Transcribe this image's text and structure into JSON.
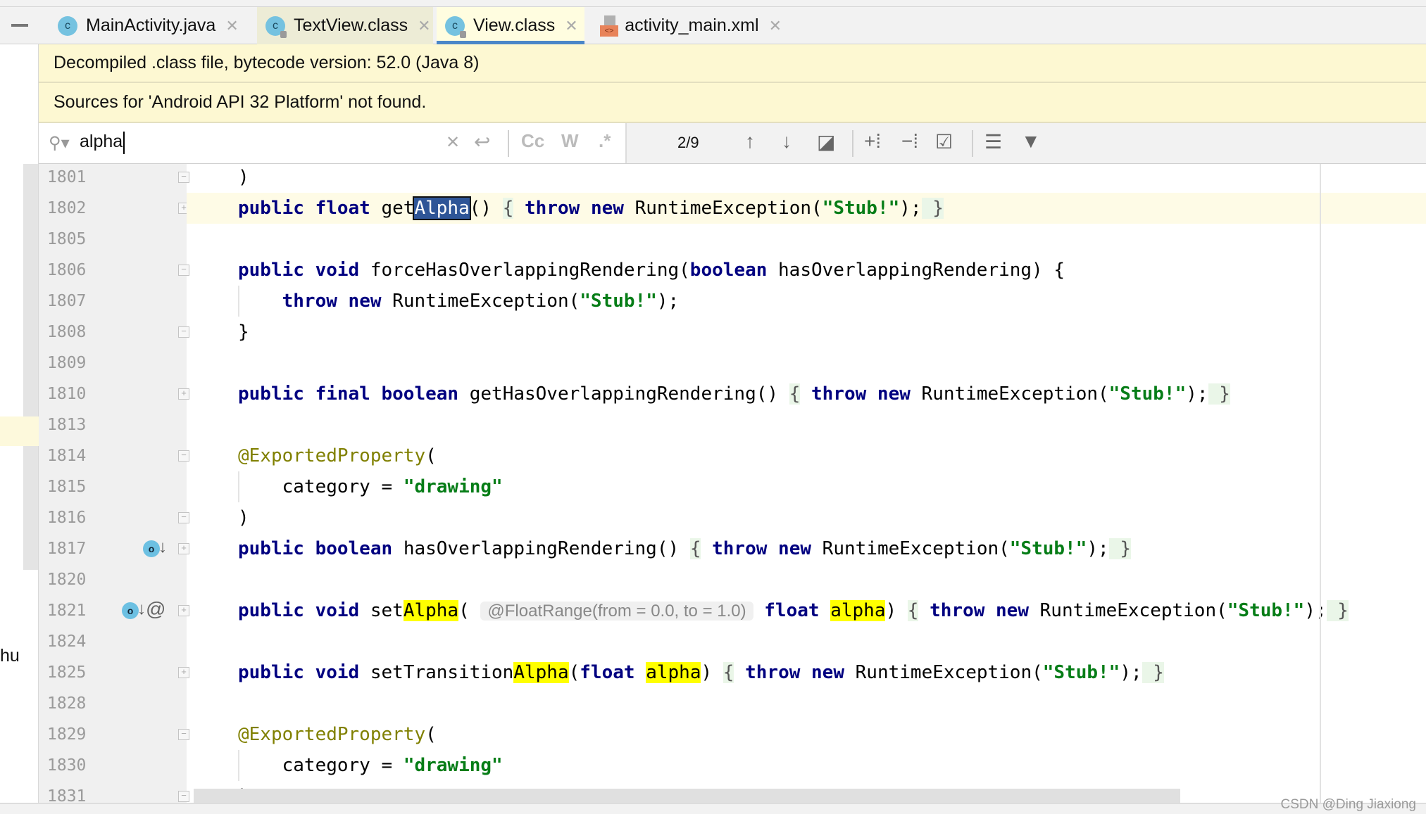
{
  "tabs": [
    {
      "label": "MainActivity.java",
      "icon": "class-icon",
      "state": "normal"
    },
    {
      "label": "TextView.class",
      "icon": "class-locked-icon",
      "state": "alt"
    },
    {
      "label": "View.class",
      "icon": "class-locked-icon",
      "state": "selected"
    },
    {
      "label": "activity_main.xml",
      "icon": "xml-layout-icon",
      "state": "normal"
    }
  ],
  "banners": [
    "Decompiled .class file, bytecode version: 52.0 (Java 8)",
    "Sources for 'Android API 32 Platform' not found."
  ],
  "search": {
    "query": "alpha",
    "count": "2/9",
    "buttons": {
      "match_case": "Cc",
      "words": "W",
      "regex": ".*"
    }
  },
  "side_text": "hu",
  "watermark": "CSDN @Ding Jiaxiong",
  "accent": "#4a86c8",
  "lines": [
    {
      "n": "1801",
      "fold": "end",
      "t": [
        [
          "p",
          ")"
        ]
      ]
    },
    {
      "n": "1802",
      "fold": "plus",
      "cur": true,
      "t": [
        [
          "kw",
          "public float "
        ],
        [
          "p",
          "get"
        ],
        [
          "sel",
          "Alpha"
        ],
        [
          "p",
          "() "
        ],
        [
          "fb",
          "{"
        ],
        [
          "p",
          " "
        ],
        [
          "kw",
          "throw new "
        ],
        [
          "p",
          "RuntimeException("
        ],
        [
          "str",
          "\"Stub!\""
        ],
        [
          "p",
          ");"
        ],
        [
          "fb",
          " }"
        ]
      ]
    },
    {
      "n": "1805",
      "t": []
    },
    {
      "n": "1806",
      "fold": "minus",
      "t": [
        [
          "kw",
          "public void "
        ],
        [
          "p",
          "forceHasOverlappingRendering("
        ],
        [
          "kw",
          "boolean "
        ],
        [
          "p",
          "hasOverlappingRendering) {"
        ]
      ]
    },
    {
      "n": "1807",
      "guide": true,
      "t": [
        [
          "p",
          "    "
        ],
        [
          "kw",
          "throw new "
        ],
        [
          "p",
          "RuntimeException("
        ],
        [
          "str",
          "\"Stub!\""
        ],
        [
          "p",
          ");"
        ]
      ]
    },
    {
      "n": "1808",
      "fold": "end",
      "t": [
        [
          "p",
          "}"
        ]
      ]
    },
    {
      "n": "1809",
      "t": []
    },
    {
      "n": "1810",
      "fold": "plus",
      "t": [
        [
          "kw",
          "public final boolean "
        ],
        [
          "p",
          "getHasOverlappingRendering() "
        ],
        [
          "fb",
          "{"
        ],
        [
          "p",
          " "
        ],
        [
          "kw",
          "throw new "
        ],
        [
          "p",
          "RuntimeException("
        ],
        [
          "str",
          "\"Stub!\""
        ],
        [
          "p",
          ");"
        ],
        [
          "fb",
          " }"
        ]
      ]
    },
    {
      "n": "1813",
      "t": []
    },
    {
      "n": "1814",
      "fold": "minus",
      "t": [
        [
          "ann",
          "@ExportedProperty"
        ],
        [
          "p",
          "("
        ]
      ]
    },
    {
      "n": "1815",
      "guide": true,
      "t": [
        [
          "p",
          "    category = "
        ],
        [
          "str",
          "\"drawing\""
        ]
      ]
    },
    {
      "n": "1816",
      "fold": "end",
      "t": [
        [
          "p",
          ")"
        ]
      ]
    },
    {
      "n": "1817",
      "fold": "plus",
      "gutter": [
        "override-icon"
      ],
      "t": [
        [
          "kw",
          "public boolean "
        ],
        [
          "p",
          "hasOverlappingRendering() "
        ],
        [
          "fb",
          "{"
        ],
        [
          "p",
          " "
        ],
        [
          "kw",
          "throw new "
        ],
        [
          "p",
          "RuntimeException("
        ],
        [
          "str",
          "\"Stub!\""
        ],
        [
          "p",
          ");"
        ],
        [
          "fb",
          " }"
        ]
      ]
    },
    {
      "n": "1820",
      "t": []
    },
    {
      "n": "1821",
      "fold": "plus",
      "gutter": [
        "override-icon",
        "annotation-icon"
      ],
      "t": [
        [
          "kw",
          "public void "
        ],
        [
          "p",
          "set"
        ],
        [
          "hl",
          "Alpha"
        ],
        [
          "p",
          "( "
        ],
        [
          "hint",
          "@FloatRange(from = 0.0, to = 1.0)"
        ],
        [
          "p",
          " "
        ],
        [
          "kw",
          "float "
        ],
        [
          "hl",
          "alpha"
        ],
        [
          "p",
          ") "
        ],
        [
          "fb",
          "{"
        ],
        [
          "p",
          " "
        ],
        [
          "kw",
          "throw new "
        ],
        [
          "p",
          "RuntimeException("
        ],
        [
          "str",
          "\"Stub!\""
        ],
        [
          "p",
          ");"
        ],
        [
          "fb",
          " }"
        ]
      ]
    },
    {
      "n": "1824",
      "t": []
    },
    {
      "n": "1825",
      "fold": "plus",
      "t": [
        [
          "kw",
          "public void "
        ],
        [
          "p",
          "setTransition"
        ],
        [
          "hl",
          "Alpha"
        ],
        [
          "p",
          "("
        ],
        [
          "kw",
          "float "
        ],
        [
          "hl",
          "alpha"
        ],
        [
          "p",
          ") "
        ],
        [
          "fb",
          "{"
        ],
        [
          "p",
          " "
        ],
        [
          "kw",
          "throw new "
        ],
        [
          "p",
          "RuntimeException("
        ],
        [
          "str",
          "\"Stub!\""
        ],
        [
          "p",
          ");"
        ],
        [
          "fb",
          " }"
        ]
      ]
    },
    {
      "n": "1828",
      "t": []
    },
    {
      "n": "1829",
      "fold": "minus",
      "t": [
        [
          "ann",
          "@ExportedProperty"
        ],
        [
          "p",
          "("
        ]
      ]
    },
    {
      "n": "1830",
      "guide": true,
      "t": [
        [
          "p",
          "    category = "
        ],
        [
          "str",
          "\"drawing\""
        ]
      ]
    },
    {
      "n": "1831",
      "fold": "end",
      "t": [
        [
          "p",
          ")"
        ]
      ]
    }
  ]
}
